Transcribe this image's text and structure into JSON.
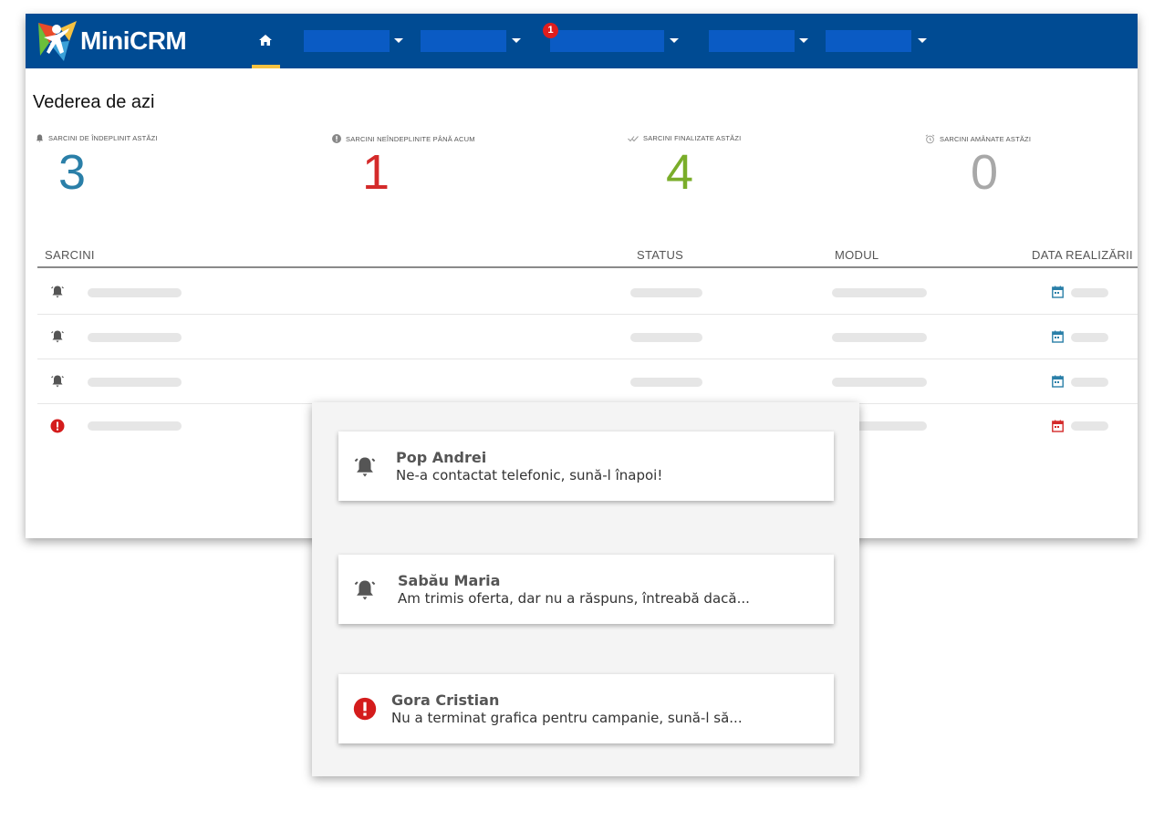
{
  "header": {
    "brand": "MiniCRM",
    "home_icon": "home-icon",
    "notification_count": "1",
    "colors": {
      "bar": "#004b93",
      "menu_block": "#0a5bc4",
      "active_underline": "#f5c242",
      "badge": "#e01d1d"
    }
  },
  "page": {
    "title": "Vederea de azi"
  },
  "stats": [
    {
      "label": "SARCINI DE ÎNDEPLINIT ASTĂZI",
      "value": "3",
      "icon": "bell-icon",
      "color": "#2a7fa8"
    },
    {
      "label": "SARCINI NEÎNDEPLINITE PÂNĂ ACUM",
      "value": "1",
      "icon": "alert-icon",
      "color": "#d42a2a"
    },
    {
      "label": "SARCINI FINALIZATE ASTĂZI",
      "value": "4",
      "icon": "double-check-icon",
      "color": "#7aad2a"
    },
    {
      "label": "SARCINI AMÂNATE ASTĂZI",
      "value": "0",
      "icon": "alarm-clock-icon",
      "color": "#a8a8a8"
    }
  ],
  "table": {
    "headers": {
      "tasks": "SARCINI",
      "status": "STATUS",
      "module": "MODUL",
      "due": "DATA REALIZĂRII"
    },
    "rows": [
      {
        "icon": "bell-icon",
        "calendar_color": "#2a7fa8"
      },
      {
        "icon": "bell-icon",
        "calendar_color": "#2a7fa8"
      },
      {
        "icon": "bell-icon",
        "calendar_color": "#2a7fa8"
      },
      {
        "icon": "alert-icon",
        "calendar_color": "#d42a2a"
      }
    ]
  },
  "notifications": [
    {
      "name": "Pop Andrei",
      "message": "Ne-a contactat telefonic, sună-l înapoi!",
      "icon": "bell-icon"
    },
    {
      "name": "Sabău Maria",
      "message": "Am trimis oferta, dar nu a răspuns, întreabă dacă...",
      "icon": "bell-icon"
    },
    {
      "name": "Gora Cristian",
      "message": "Nu a terminat grafica pentru campanie, sună-l să...",
      "icon": "alert-icon"
    }
  ]
}
